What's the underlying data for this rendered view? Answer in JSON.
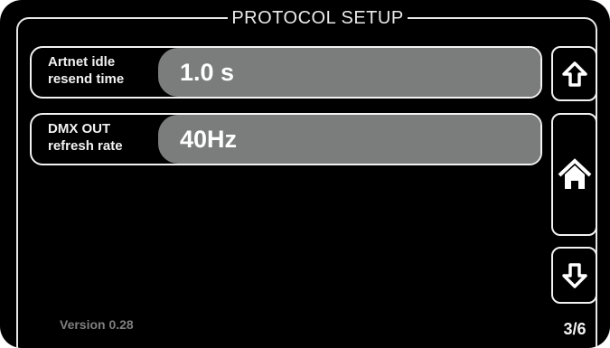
{
  "header": {
    "title": "PROTOCOL SETUP"
  },
  "settings": [
    {
      "label_line1": "Artnet idle",
      "label_line2": "resend time",
      "value": "1.0 s"
    },
    {
      "label_line1": "DMX OUT",
      "label_line2": "refresh rate",
      "value": "40Hz"
    }
  ],
  "nav": {
    "up_icon": "arrow-up-icon",
    "home_icon": "home-icon",
    "down_icon": "arrow-down-icon"
  },
  "footer": {
    "version": "Version 0.28",
    "page": "3/6"
  },
  "colors": {
    "background": "#000000",
    "border": "#f2f2f2",
    "value_fill": "#7b7c7c",
    "version_text": "#7f7f7f"
  }
}
